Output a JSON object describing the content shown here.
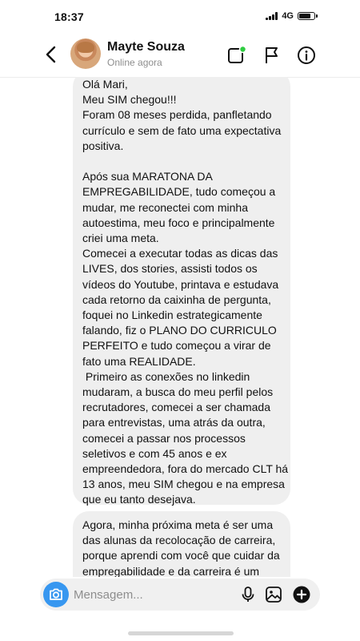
{
  "status_bar": {
    "time": "18:37",
    "network": "4G"
  },
  "header": {
    "contact_name": "Mayte Souza",
    "contact_status": "Online agora",
    "icons": [
      "back-chevron-icon",
      "video-call-icon",
      "flag-icon",
      "info-icon"
    ]
  },
  "messages": [
    {
      "text": "Olá Mari,\nMeu SIM chegou!!!\nForam 08 meses perdida, panfletando currículo e sem de fato uma expectativa positiva.\n\nApós sua MARATONA DA EMPREGABILIDADE, tudo começou a mudar, me reconectei com minha autoestima, meu foco e principalmente criei uma meta.\nComecei a executar todas as dicas das LIVES, dos stories, assisti todos os vídeos do Youtube, printava e estudava cada retorno da caixinha de pergunta, foquei no Linkedin estrategicamente falando, fiz o PLANO DO CURRICULO PERFEITO e tudo começou a virar de fato uma REALIDADE.\n Primeiro as conexões no linkedin mudaram, a busca do meu perfil pelos recrutadores, comecei a ser chamada para entrevistas, uma atrás da outra, comecei a passar nos processos seletivos e com 45 anos e ex empreendedora, fora do mercado CLT há 13 anos, meu SIM chegou e na empresa que eu tanto desejava."
    },
    {
      "text": "Agora, minha próxima meta é ser uma das alunas da recolocação de carreira, porque aprendi com você que cuidar da empregabilidade e da carreira é um"
    }
  ],
  "composer": {
    "placeholder": "Mensagem...",
    "icons": [
      "camera-icon",
      "microphone-icon",
      "gallery-icon",
      "add-icon"
    ]
  },
  "colors": {
    "bubble_bg": "#efefef",
    "accent": "#3797f0",
    "online_dot": "#2ecc40"
  }
}
